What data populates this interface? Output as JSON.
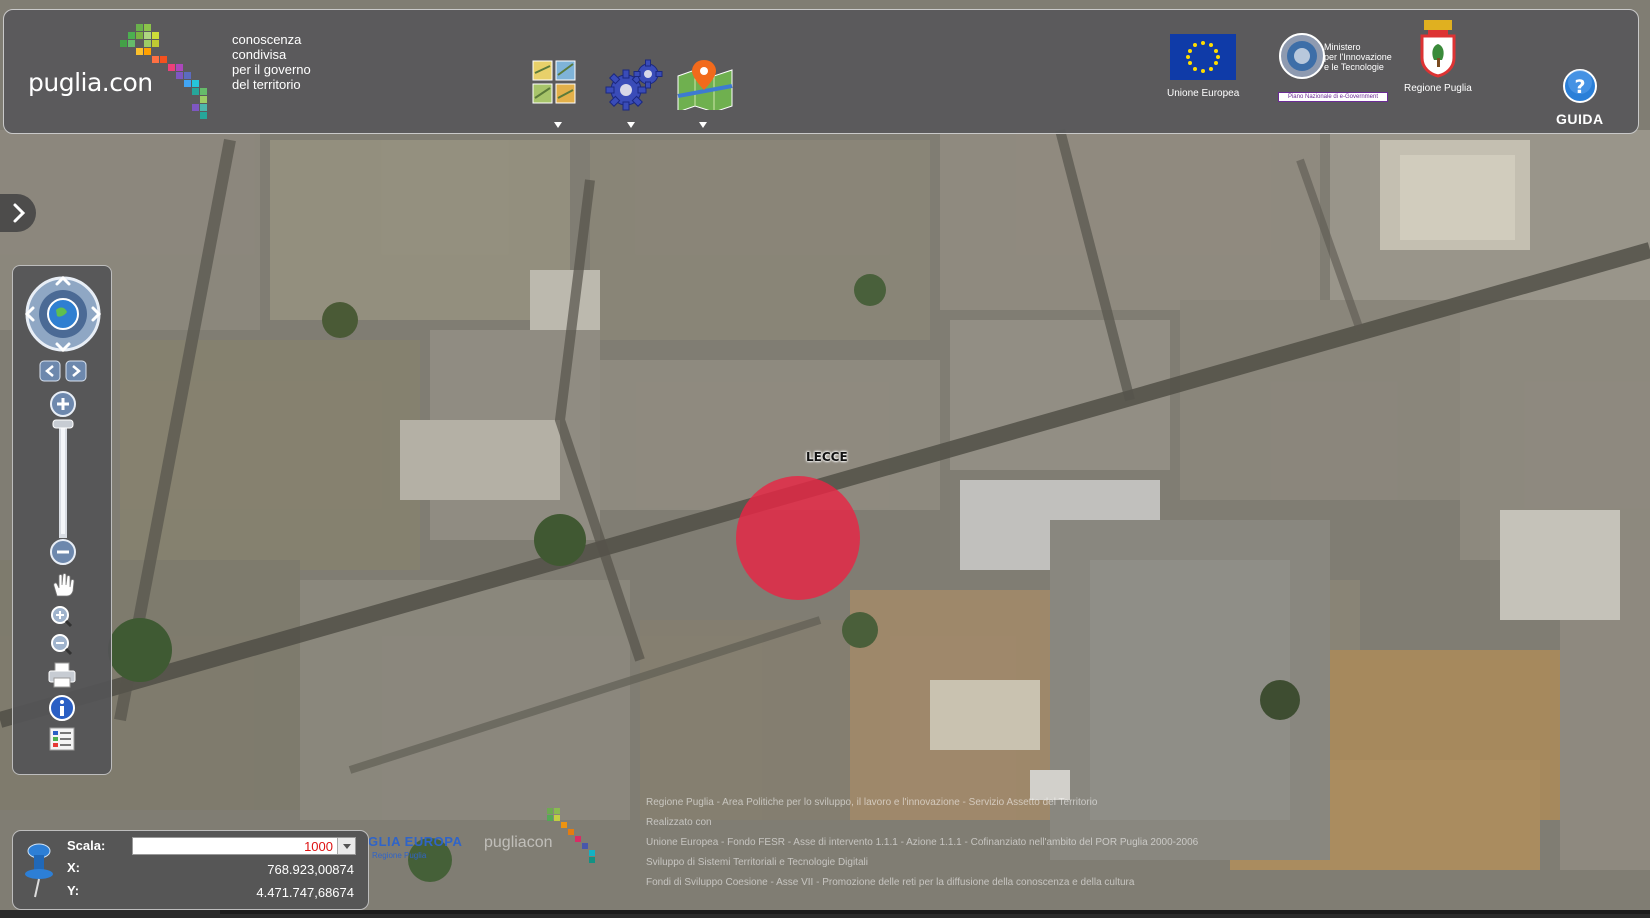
{
  "header": {
    "brand": "puglia.con",
    "tagline": [
      "conoscenza",
      "condivisa",
      "per il governo",
      "del territorio"
    ],
    "tools": [
      {
        "name": "layers-tool",
        "icon": "map-tiles-icon"
      },
      {
        "name": "settings-tool",
        "icon": "gears-icon"
      },
      {
        "name": "locate-tool",
        "icon": "map-pin-icon"
      }
    ],
    "logos": {
      "eu_caption": "Unione Europea",
      "ministry_text": [
        "Ministero",
        "per l'Innovazione",
        "e le Tecnologie"
      ],
      "ministry_strip": "Piano Nazionale di e-Government",
      "region_caption": "Regione Puglia"
    },
    "help_label": "GUIDA"
  },
  "map": {
    "city_label": "LECCE",
    "credits": [
      "Regione Puglia - Area Politiche per lo sviluppo, il lavoro e l'innovazione - Servizio Assetto del Territorio",
      "Realizzato con",
      "Unione Europea - Fondo FESR - Asse di intervento 1.1.1 - Azione 1.1.1 - Cofinanziato nell'ambito del POR Puglia 2000-2006",
      "Sviluppo di Sistemi Territoriali e Tecnologie Digitali",
      "Fondi di Sviluppo Coesione - Asse VII - Promozione delle reti per la diffusione della conoscenza e della cultura"
    ],
    "partner_logo": "GLIA EUROPA",
    "partner_sub": "Regione Puglia",
    "partner_logo2": "pugliacon"
  },
  "coords": {
    "scale_label": "Scala:",
    "scale_value": "1000",
    "x_label": "X:",
    "x_value": "768.923,00874",
    "y_label": "Y:",
    "y_value": "4.471.747,68674"
  },
  "colors": {
    "marker": "#e82644",
    "panel": "#58585a",
    "eu_blue": "#0f3ba8",
    "help_blue": "#2a7fd8"
  }
}
